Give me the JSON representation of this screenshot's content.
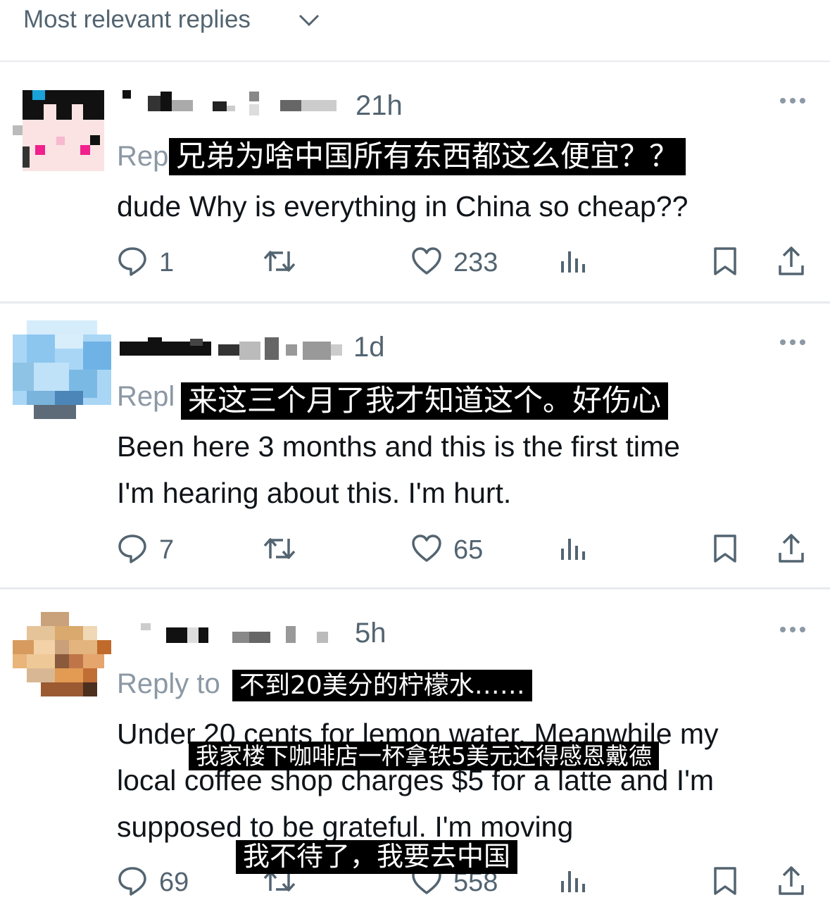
{
  "header": {
    "sort_label": "Most relevant replies",
    "chevron_icon": "chevron-down-icon"
  },
  "replies": [
    {
      "time": "21h",
      "reply_to": "Rep",
      "chinese_caption": "兄弟为啥中国所有东西都这么便宜？？",
      "text": "dude Why is everything in China so cheap??",
      "replies_count": "1",
      "likes_count": "233"
    },
    {
      "time": "1d",
      "reply_to": "Repl",
      "chinese_caption": "来这三个月了我才知道这个。好伤心",
      "text_line1": "Been here 3 months and this is the first time",
      "text_line2": "I'm hearing about this. I'm hurt.",
      "replies_count": "7",
      "likes_count": "65"
    },
    {
      "time": "5h",
      "reply_to": "Reply to",
      "chinese_caption1": "不到20美分的柠檬水……",
      "chinese_caption2": "我家楼下咖啡店一杯拿铁5美元还得感恩戴德",
      "chinese_caption3": "我不待了，我要去中国",
      "text_line1": "Under 20 cents for lemon water. Meanwhile my",
      "text_line2": "local coffee shop charges $5 for a latte and I'm",
      "text_line3": "supposed to be grateful. I'm moving",
      "replies_count": "69",
      "likes_count": "558"
    }
  ],
  "icons": [
    "reply-icon",
    "retweet-icon",
    "like-icon",
    "views-icon",
    "bookmark-icon",
    "share-icon",
    "more-icon"
  ],
  "colors": {
    "text": "#0f1419",
    "secondary": "#536471",
    "divider": "#e8eaed",
    "caption_bg": "#000000"
  }
}
